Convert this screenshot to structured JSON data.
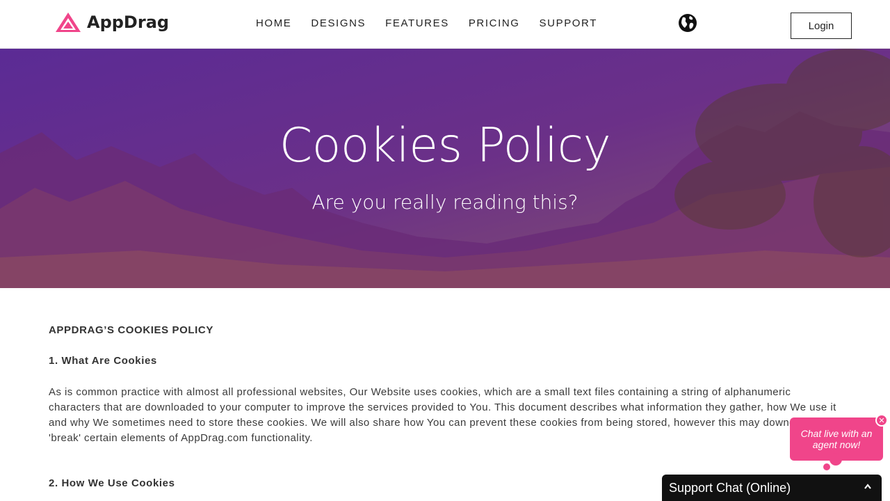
{
  "header": {
    "logo_text": "AppDrag",
    "nav": [
      "HOME",
      "DESIGNS",
      "FEATURES",
      "PRICING",
      "SUPPORT"
    ],
    "login_label": "Login"
  },
  "hero": {
    "title": "Cookies Policy",
    "subtitle": "Are you really reading this?"
  },
  "content": {
    "main_heading": "APPDRAG’S COOKIES POLICY",
    "section1_heading": "1. What Are Cookies",
    "section1_text": "As is common practice with almost all professional websites, Our Website uses cookies, which are a small text files containing a string of alphanumeric characters that are downloaded to your computer to improve the services provided to You. This document describes what information they gather, how We use it and why We sometimes need to store these cookies. We will also share how You can prevent these cookies from being stored, however this may downgrade or 'break' certain elements of AppDrag.com functionality.",
    "section2_heading": "2. How We Use Cookies"
  },
  "chat": {
    "bubble_text": "Chat live with an agent now!",
    "bar_label": "Support Chat (Online)"
  },
  "colors": {
    "accent": "#f0458a",
    "hero": "#6a2f85",
    "chat_bar": "#111111"
  }
}
